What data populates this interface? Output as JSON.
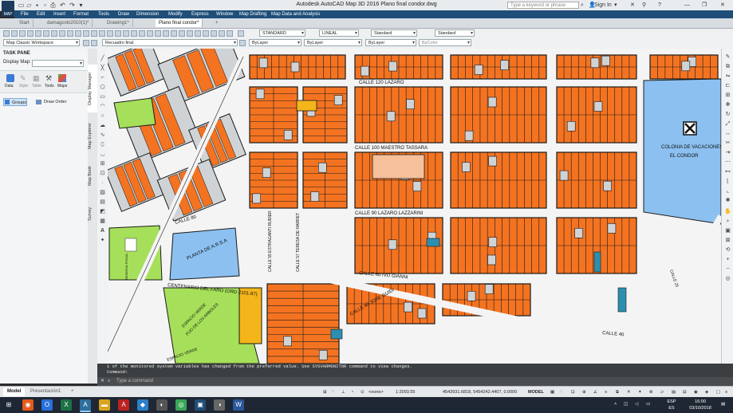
{
  "app": {
    "title": "Autodesk AutoCAD Map 3D 2016   Plano final condor.dwg",
    "logo": "MAP",
    "search_placeholder": "Type a keyword or phrase",
    "sign_in": "Sign In",
    "help": "?"
  },
  "menu": [
    "File",
    "Edit",
    "Insert",
    "Format",
    "Tools",
    "Draw",
    "Dimension",
    "Modify",
    "Express",
    "Window",
    "Map Drafting",
    "Map Data and Analysis"
  ],
  "doc_tabs": [
    {
      "label": "Start",
      "active": false
    },
    {
      "label": "damagcolo2010(1)*",
      "active": false
    },
    {
      "label": "Drawing1*",
      "active": false
    },
    {
      "label": "Plano final condor*",
      "active": true
    }
  ],
  "toolbar1": {
    "text_style": "STANDARD",
    "linetype": "LINEAL",
    "dim_style": "Standard",
    "table_style": "Standard"
  },
  "toolbar2": {
    "workspace": "Map Classic Workspace",
    "layer": "Recuadro final",
    "color": "ByLayer",
    "linetype": "ByLayer",
    "lineweight": "ByLayer",
    "plotstyle": "ByColor"
  },
  "task_pane": {
    "title": "TASK PANE",
    "display_map_label": "Display Map:",
    "tools": [
      "Data",
      "Style",
      "Table",
      "Tools",
      "Maps"
    ],
    "groups_btn": "Groups",
    "draw_order_btn": "Draw Order",
    "side_tabs": [
      "Display Manager",
      "Map Explorer",
      "Map Book",
      "Survey"
    ]
  },
  "map": {
    "street_labels": [
      "CALLE 120 LAZARO",
      "CALLE 100 MAESTRO TASSARA",
      "CALLE 90 LAZARO LAZZARINI",
      "CALLE 80",
      "CALLE 60 IVO GIANNI",
      "CALLE 40 JOSE GUIDI",
      "CALLE 40",
      "CENTENARIO DEL FARO (ORD 2101-87)",
      "CALLE 55 ESTRAGANTI RUDIER",
      "CALLE 57 TERESA DE HARRET",
      "PLANTA DE A.R.S.A",
      "COLONIA DE VACACIONES",
      "EL CONDOR",
      "ESPACIO VERDE",
      "FIJO DE LOS ARBOLES",
      "RESERVA FISCAL",
      "ESPACIO VERDE",
      "CALLE 25"
    ],
    "colors": {
      "lot": "#f47321",
      "road": "#f0f0f0",
      "block_line": "#1a1a1a",
      "green": "#a6e05a",
      "blue": "#8cc0f0",
      "gray": "#cfd3d6",
      "teal": "#2c8fb0",
      "yellow": "#f4b51b"
    }
  },
  "command": {
    "history": "1 of the monitored system variables has changed from the preferred value. Use SYSVARMONITOR command to view changes.",
    "prompt": "Command:",
    "placeholder": "Type a command"
  },
  "layout_tabs": [
    "Model",
    "Presentación1"
  ],
  "status": {
    "coords": "4543931.6818, 5454242.4407, 0.0000",
    "space": "MODEL",
    "scale": "1:2093.55",
    "annotate": "<none>"
  },
  "taskbar": {
    "lang": "ESP\nES",
    "time": "16:00",
    "date": "03/10/2018"
  }
}
